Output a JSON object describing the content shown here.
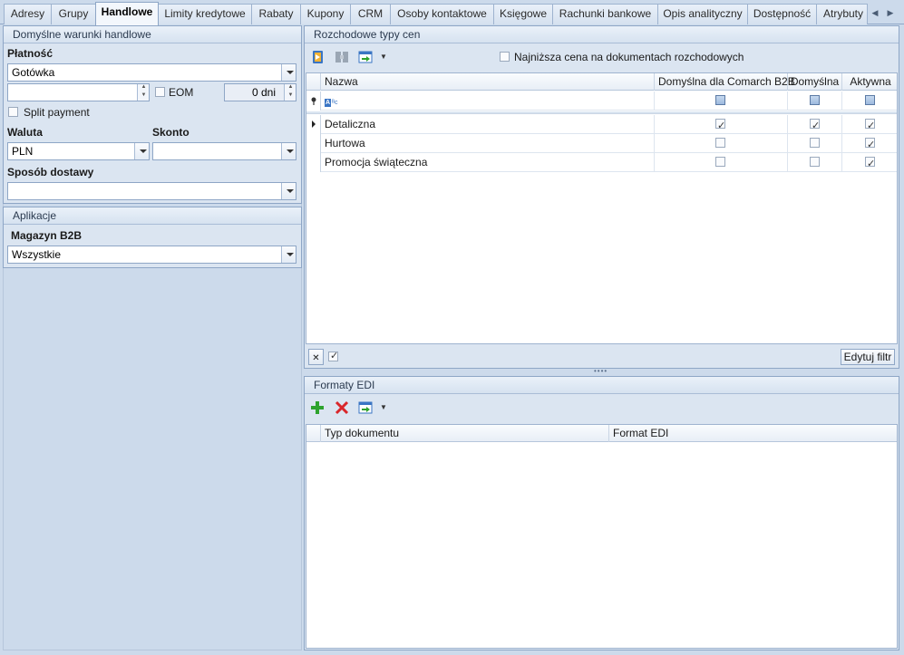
{
  "tabs": [
    {
      "label": "Adresy"
    },
    {
      "label": "Grupy"
    },
    {
      "label": "Handlowe"
    },
    {
      "label": "Limity kredytowe"
    },
    {
      "label": "Rabaty"
    },
    {
      "label": "Kupony"
    },
    {
      "label": "CRM"
    },
    {
      "label": "Osoby kontaktowe"
    },
    {
      "label": "Księgowe"
    },
    {
      "label": "Rachunki bankowe"
    },
    {
      "label": "Opis analityczny"
    },
    {
      "label": "Dostępność"
    },
    {
      "label": "Atrybuty"
    }
  ],
  "left": {
    "title": "Domyślne warunki handlowe",
    "payment_label": "Płatność",
    "payment_value": "Gotówka",
    "days_input_value": "",
    "eom_label": "EOM",
    "days_value": "0 dni",
    "split_payment_label": "Split payment",
    "currency_label": "Waluta",
    "currency_value": "PLN",
    "discount_label": "Skonto",
    "discount_value": "",
    "delivery_label": "Sposób dostawy",
    "delivery_value": ""
  },
  "app": {
    "title": "Aplikacje",
    "warehouse_label": "Magazyn B2B",
    "warehouse_value": "Wszystkie"
  },
  "prices": {
    "title": "Rozchodowe typy cen",
    "lowest_price_label": "Najniższa cena na dokumentach rozchodowych",
    "columns": [
      "Nazwa",
      "Domyślna dla Comarch B2B",
      "Domyślna",
      "Aktywna"
    ],
    "filter_placeholder": "ᴮᴄ",
    "rows": [
      {
        "name": "Detaliczna",
        "b2b": true,
        "default": true,
        "active": true
      },
      {
        "name": "Hurtowa",
        "b2b": false,
        "default": false,
        "active": true
      },
      {
        "name": "Promocja świąteczna",
        "b2b": false,
        "default": false,
        "active": true
      }
    ],
    "edit_filter_label": "Edytuj filtr"
  },
  "edi": {
    "title": "Formaty EDI",
    "columns": [
      "Typ dokumentu",
      "Format EDI"
    ]
  },
  "colors": {
    "accent_blue": "#3a75c4",
    "add_green": "#2ea32e",
    "delete_red": "#d9262a"
  }
}
